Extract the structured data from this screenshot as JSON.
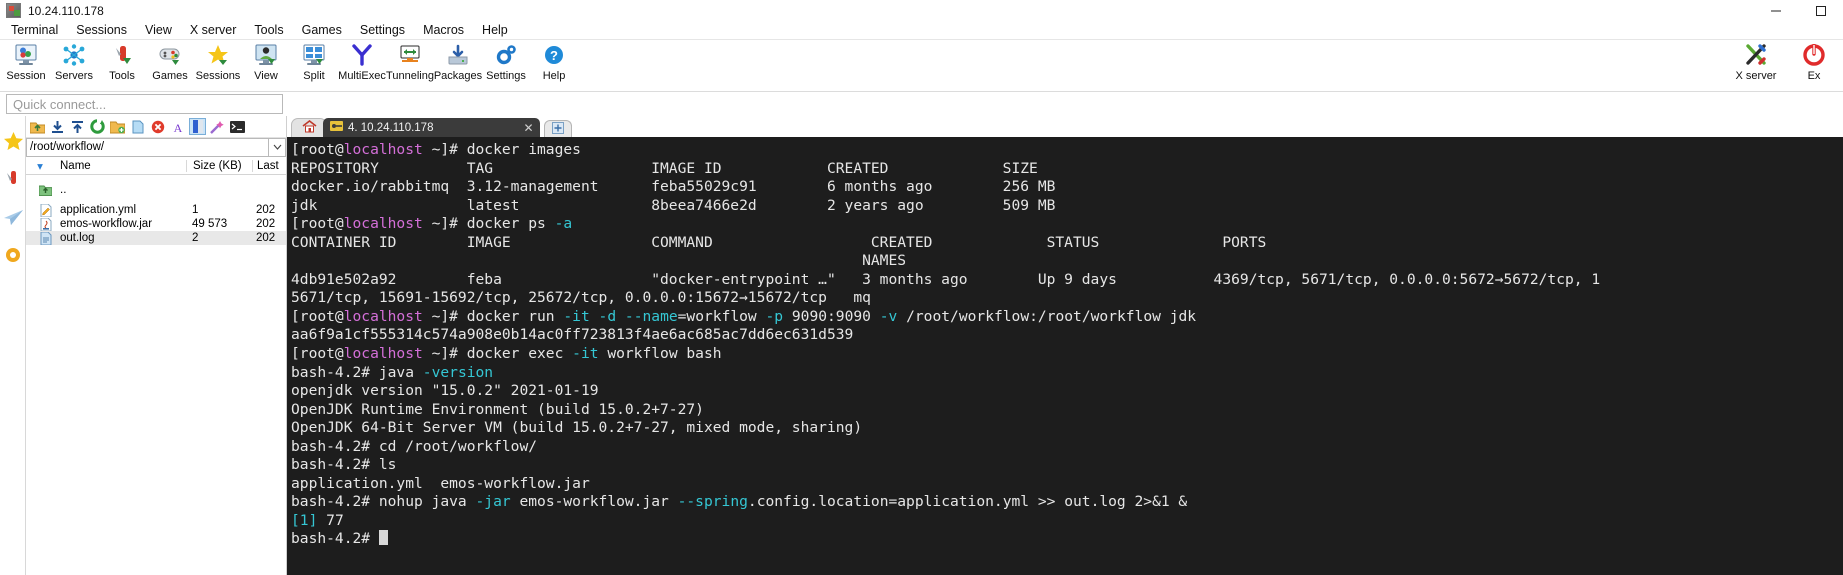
{
  "window": {
    "title": "10.24.110.178",
    "app_icon": "mobaxterm-icon",
    "minimize": "minimize-button",
    "maximize": "maximize-button"
  },
  "menubar": {
    "items": [
      "Terminal",
      "Sessions",
      "View",
      "X server",
      "Tools",
      "Games",
      "Settings",
      "Macros",
      "Help"
    ]
  },
  "toolbar": {
    "items": [
      {
        "label": "Session",
        "icon": "session-icon"
      },
      {
        "label": "Servers",
        "icon": "servers-icon"
      },
      {
        "label": "Tools",
        "icon": "tools-icon"
      },
      {
        "label": "Games",
        "icon": "games-icon"
      },
      {
        "label": "Sessions",
        "icon": "sessions-star-icon"
      },
      {
        "label": "View",
        "icon": "view-icon"
      },
      {
        "label": "Split",
        "icon": "split-icon"
      },
      {
        "label": "MultiExec",
        "icon": "multiexec-icon"
      },
      {
        "label": "Tunneling",
        "icon": "tunneling-icon"
      },
      {
        "label": "Packages",
        "icon": "packages-icon"
      },
      {
        "label": "Settings",
        "icon": "settings-gear-icon"
      },
      {
        "label": "Help",
        "icon": "help-question-icon"
      }
    ],
    "right_items": [
      {
        "label": "X server",
        "icon": "x-server-icon"
      },
      {
        "label": "Ex",
        "icon": "exit-power-icon"
      }
    ]
  },
  "quick_connect": {
    "placeholder": "Quick connect..."
  },
  "rail": {
    "items": [
      {
        "icon": "star-favorites-icon"
      },
      {
        "icon": "tools-knife-icon"
      },
      {
        "icon": "paper-plane-sftp-icon"
      },
      {
        "icon": "macro-orb-icon"
      }
    ]
  },
  "sftp": {
    "tools": [
      {
        "icon": "up-folder-icon"
      },
      {
        "icon": "download-icon"
      },
      {
        "icon": "upload-icon"
      },
      {
        "icon": "refresh-icon"
      },
      {
        "icon": "new-folder-icon"
      },
      {
        "icon": "new-file-icon"
      },
      {
        "icon": "delete-icon"
      },
      {
        "icon": "text-mode-icon"
      },
      {
        "icon": "binary-mode-icon",
        "selected": true
      },
      {
        "icon": "magic-follow-icon"
      },
      {
        "icon": "terminal-icon"
      }
    ],
    "path": "/root/workflow/",
    "columns": {
      "name": "Name",
      "size": "Size (KB)",
      "last": "Last"
    },
    "rows": [
      {
        "icon": "parent-folder-icon",
        "name": "..",
        "size": "",
        "last": ""
      },
      {
        "icon": "yml-file-icon",
        "name": "application.yml",
        "size": "1",
        "last": "202"
      },
      {
        "icon": "jar-file-icon",
        "name": "emos-workflow.jar",
        "size": "49 573",
        "last": "202"
      },
      {
        "icon": "log-file-icon",
        "name": "out.log",
        "size": "2",
        "last": "202",
        "selected": true
      }
    ]
  },
  "tabs": {
    "home_icon": "home-tab-icon",
    "active": {
      "icon": "session-tab-icon",
      "label": "4. 10.24.110.178",
      "close": "close-tab-icon"
    },
    "new_tab": "new-tab-plus-icon"
  },
  "terminal": {
    "lines": [
      [
        {
          "t": "[root@",
          "c": ""
        },
        {
          "t": "localhost",
          "c": "c-mag"
        },
        {
          "t": " ~]# ",
          "c": ""
        },
        {
          "t": "docker images",
          "c": ""
        }
      ],
      [
        {
          "t": "REPOSITORY          TAG                  IMAGE ID            CREATED             SIZE",
          "c": ""
        }
      ],
      [
        {
          "t": "docker.io/rabbitmq  3.12-management      feba55029c91        6 months ago        256 MB",
          "c": ""
        }
      ],
      [
        {
          "t": "jdk                 latest               8beea7466e2d        2 years ago         509 MB",
          "c": ""
        }
      ],
      [
        {
          "t": "[root@",
          "c": ""
        },
        {
          "t": "localhost",
          "c": "c-mag"
        },
        {
          "t": " ~]# ",
          "c": ""
        },
        {
          "t": "docker ps ",
          "c": ""
        },
        {
          "t": "-a",
          "c": "c-cyan"
        }
      ],
      [
        {
          "t": "CONTAINER ID        IMAGE                COMMAND                  CREATED             STATUS              PORTS",
          "c": ""
        }
      ],
      [
        {
          "t": "                                                                 NAMES",
          "c": ""
        }
      ],
      [
        {
          "t": "4db91e502a92        feba                 \"docker-entrypoint …\"   3 months ago        Up 9 days           4369/tcp, 5671/tcp, 0.0.0.0:5672→5672/tcp, 1",
          "c": ""
        }
      ],
      [
        {
          "t": "5671/tcp, 15691-15692/tcp, 25672/tcp, 0.0.0.0:15672→15672/tcp   mq",
          "c": ""
        }
      ],
      [
        {
          "t": "[root@",
          "c": ""
        },
        {
          "t": "localhost",
          "c": "c-mag"
        },
        {
          "t": " ~]# ",
          "c": ""
        },
        {
          "t": "docker run ",
          "c": ""
        },
        {
          "t": "-it",
          "c": "c-cyan"
        },
        {
          "t": " ",
          "c": ""
        },
        {
          "t": "-d",
          "c": "c-cyan"
        },
        {
          "t": " ",
          "c": ""
        },
        {
          "t": "--name",
          "c": "c-cyan"
        },
        {
          "t": "=workflow ",
          "c": ""
        },
        {
          "t": "-p",
          "c": "c-cyan"
        },
        {
          "t": " 9090:9090 ",
          "c": ""
        },
        {
          "t": "-v",
          "c": "c-cyan"
        },
        {
          "t": " /root/workflow:/root/workflow jdk",
          "c": ""
        }
      ],
      [
        {
          "t": "aa6f9a1cf555314c574a908e0b14ac0ff723813f4ae6ac685ac7dd6ec631d539",
          "c": ""
        }
      ],
      [
        {
          "t": "[root@",
          "c": ""
        },
        {
          "t": "localhost",
          "c": "c-mag"
        },
        {
          "t": " ~]# ",
          "c": ""
        },
        {
          "t": "docker exec ",
          "c": ""
        },
        {
          "t": "-it",
          "c": "c-cyan"
        },
        {
          "t": " workflow bash",
          "c": ""
        }
      ],
      [
        {
          "t": "bash-4.2# java ",
          "c": ""
        },
        {
          "t": "-version",
          "c": "c-cyan"
        }
      ],
      [
        {
          "t": "openjdk version \"15.0.2\" 2021-01-19",
          "c": ""
        }
      ],
      [
        {
          "t": "OpenJDK Runtime Environment (build 15.0.2+7-27)",
          "c": ""
        }
      ],
      [
        {
          "t": "OpenJDK 64-Bit Server VM (build 15.0.2+7-27, mixed mode, sharing)",
          "c": ""
        }
      ],
      [
        {
          "t": "bash-4.2# cd /root/workflow/",
          "c": ""
        }
      ],
      [
        {
          "t": "bash-4.2# ls",
          "c": ""
        }
      ],
      [
        {
          "t": "application.yml  emos-workflow.jar",
          "c": ""
        }
      ],
      [
        {
          "t": "bash-4.2# nohup java ",
          "c": ""
        },
        {
          "t": "-jar",
          "c": "c-cyan"
        },
        {
          "t": " emos-workflow.jar ",
          "c": ""
        },
        {
          "t": "--spring",
          "c": "c-cyan"
        },
        {
          "t": ".config.location=application.yml >> out.log 2>&1 &",
          "c": ""
        }
      ],
      [
        {
          "t": "[1] ",
          "c": "c-cyan"
        },
        {
          "t": "77",
          "c": ""
        }
      ],
      [
        {
          "t": "bash-4.2# ",
          "c": ""
        },
        {
          "t": "█",
          "c": "cursorglyph"
        }
      ]
    ]
  },
  "colors": {
    "terminal_bg": "#1d1d1d",
    "terminal_fg": "#e6e6e6",
    "accent_magenta": "#d46fd8",
    "accent_cyan": "#35c7d4",
    "tab_active_bg": "#3b3b3b",
    "selection_blue": "#cce4f7"
  }
}
